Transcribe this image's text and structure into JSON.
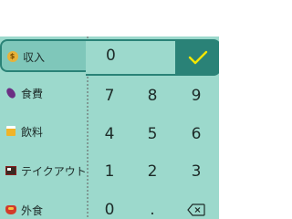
{
  "categories": [
    {
      "label": "収入",
      "icon": "coin-bag-icon",
      "selected": true
    },
    {
      "label": "食費",
      "icon": "eggplant-icon",
      "selected": false
    },
    {
      "label": "飲料",
      "icon": "beer-icon",
      "selected": false
    },
    {
      "label": "テイクアウト",
      "icon": "bento-icon",
      "selected": false
    },
    {
      "label": "外食",
      "icon": "food-icon",
      "selected": false
    }
  ],
  "amount": "0",
  "confirm_icon": "check-icon",
  "keypad": {
    "row1": [
      "7",
      "8",
      "9"
    ],
    "row2": [
      "4",
      "5",
      "6"
    ],
    "row3": [
      "1",
      "2",
      "3"
    ],
    "row4": [
      "0",
      ".",
      "backspace"
    ]
  },
  "colors": {
    "panel": "#9cd9cc",
    "accent": "#2a8277",
    "check": "#f2e600"
  }
}
